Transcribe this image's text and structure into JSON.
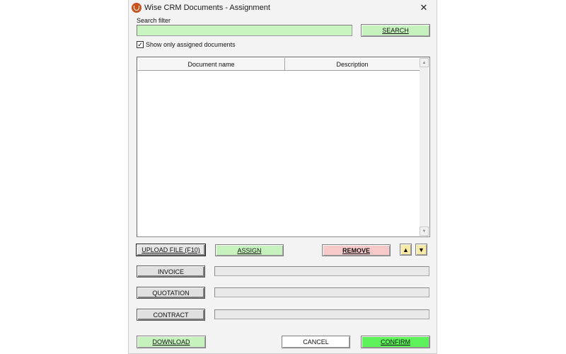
{
  "window": {
    "title": "Wise CRM Documents - Assignment",
    "close_glyph": "✕",
    "app_icon": "wise-crm-logo-icon"
  },
  "search": {
    "label": "Search filter",
    "value": "",
    "placeholder": "",
    "button_label": "SEARCH",
    "input_color": "#c9f5c1"
  },
  "filter": {
    "show_assigned_label": "Show only assigned documents",
    "show_assigned_checked": true,
    "check_glyph": "✓"
  },
  "table": {
    "columns": [
      "Document name",
      "Description"
    ],
    "rows": [],
    "scroll_up_glyph": "▲",
    "scroll_down_glyph": "▼"
  },
  "actions": {
    "upload_label": "UPLOAD FILE (F10)",
    "assign_label": "ASSIGN",
    "remove_label": "REMOVE",
    "move_up_glyph": "▲",
    "move_down_glyph": "▼"
  },
  "document_types": [
    {
      "label": "INVOICE",
      "progress": 0
    },
    {
      "label": "QUOTATION",
      "progress": 0
    },
    {
      "label": "CONTRACT",
      "progress": 0
    }
  ],
  "footer": {
    "download_label": "DOWNLOAD",
    "cancel_label": "CANCEL",
    "confirm_label": "CONFIRM"
  },
  "colors": {
    "green_button": "#c6f3bd",
    "confirm_button": "#5ef25a",
    "remove_button": "#f7c9c9",
    "arrow_button": "#f8eaa6"
  }
}
